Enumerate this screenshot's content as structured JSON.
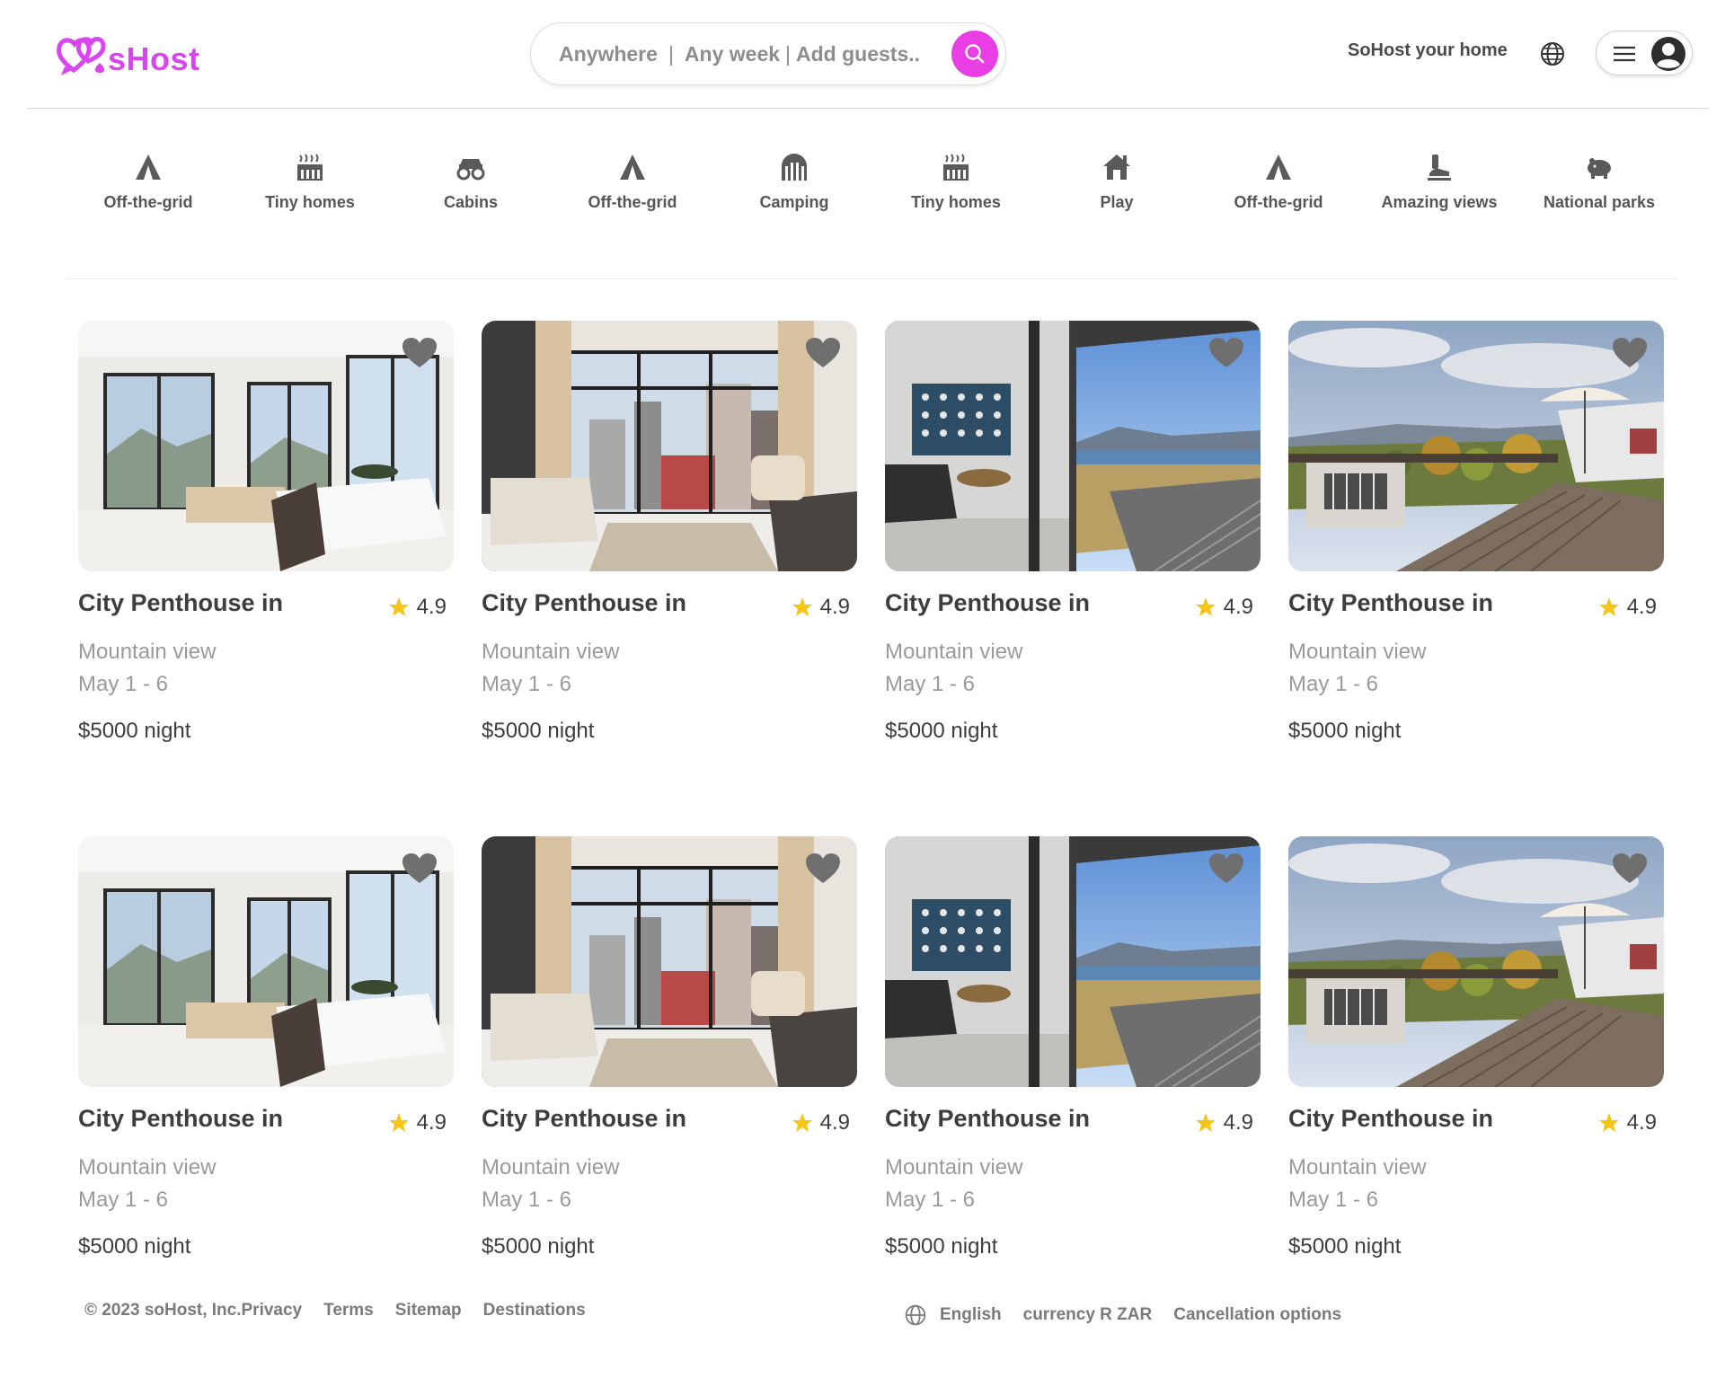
{
  "brand": {
    "name": "sHost",
    "color": "#d946ef",
    "logo_icon": "hearts-logo-icon"
  },
  "search": {
    "where": "Anywhere",
    "when": "Any week",
    "who": "Add guests..",
    "button_color": "#e83ee3",
    "icon": "search-icon"
  },
  "header": {
    "host_link": "SoHost your home",
    "globe_icon": "globe-icon",
    "menu_icon": "hamburger-icon",
    "avatar_icon": "user-avatar-icon"
  },
  "categories": [
    {
      "label": "Off-the-grid",
      "icon": "tent-icon"
    },
    {
      "label": "Tiny homes",
      "icon": "tiny-home-icon"
    },
    {
      "label": "Cabins",
      "icon": "cabin-icon"
    },
    {
      "label": "Off-the-grid",
      "icon": "tent-icon"
    },
    {
      "label": "Camping",
      "icon": "camping-icon"
    },
    {
      "label": "Tiny homes",
      "icon": "tiny-home-icon"
    },
    {
      "label": "Play",
      "icon": "play-house-icon"
    },
    {
      "label": "Off-the-grid",
      "icon": "tent-icon"
    },
    {
      "label": "Amazing views",
      "icon": "views-icon"
    },
    {
      "label": "National parks",
      "icon": "national-park-icon"
    }
  ],
  "listings": [
    {
      "title": "City Penthouse in",
      "rating": "4.9",
      "subtitle": "Mountain view",
      "dates": "May 1 - 6",
      "price": "$5000 night",
      "photo": "penthouse-living-room"
    },
    {
      "title": "City Penthouse in",
      "rating": "4.9",
      "subtitle": "Mountain view",
      "dates": "May 1 - 6",
      "price": "$5000 night",
      "photo": "apartment-city-view"
    },
    {
      "title": "City Penthouse in",
      "rating": "4.9",
      "subtitle": "Mountain view",
      "dates": "May 1 - 6",
      "price": "$5000 night",
      "photo": "beach-balcony"
    },
    {
      "title": "City Penthouse in",
      "rating": "4.9",
      "subtitle": "Mountain view",
      "dates": "May 1 - 6",
      "price": "$5000 night",
      "photo": "garden-deck"
    },
    {
      "title": "City Penthouse in",
      "rating": "4.9",
      "subtitle": "Mountain view",
      "dates": "May 1 - 6",
      "price": "$5000 night",
      "photo": "penthouse-living-room"
    },
    {
      "title": "City Penthouse in",
      "rating": "4.9",
      "subtitle": "Mountain view",
      "dates": "May 1 - 6",
      "price": "$5000 night",
      "photo": "apartment-city-view"
    },
    {
      "title": "City Penthouse in",
      "rating": "4.9",
      "subtitle": "Mountain view",
      "dates": "May 1 - 6",
      "price": "$5000 night",
      "photo": "beach-balcony"
    },
    {
      "title": "City Penthouse in",
      "rating": "4.9",
      "subtitle": "Mountain view",
      "dates": "May 1 - 6",
      "price": "$5000 night",
      "photo": "garden-deck"
    }
  ],
  "colors": {
    "star": "#f5c518",
    "heart": "#6f6f6f"
  },
  "footer": {
    "copyright": "© 2023 soHost, Inc.Privacy",
    "links": [
      "Terms",
      "Sitemap",
      "Destinations"
    ],
    "language": "English",
    "currency": "currency R ZAR",
    "cancellation": "Cancellation options"
  }
}
